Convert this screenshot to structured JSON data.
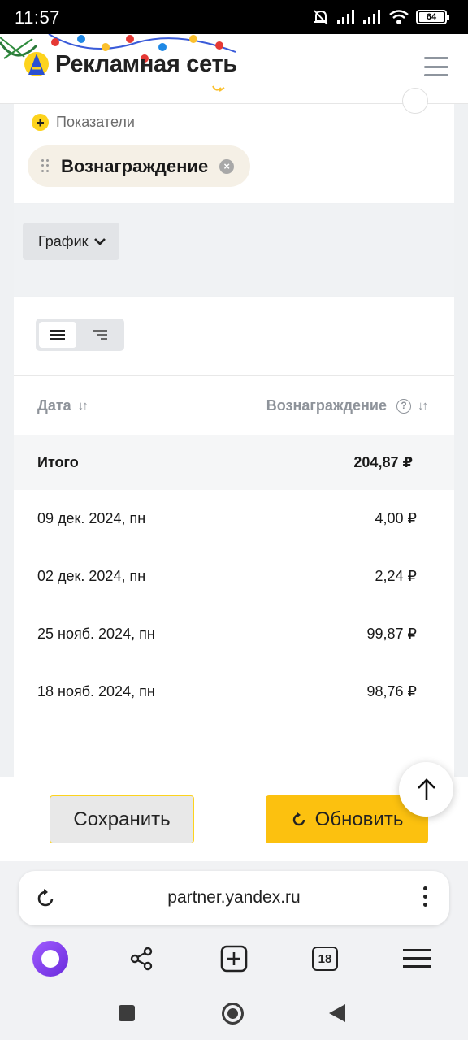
{
  "status_bar": {
    "time": "11:57",
    "battery": "64"
  },
  "header": {
    "brand": "Рекламная сеть"
  },
  "indicators": {
    "add_label": "Показатели",
    "chip_label": "Вознаграждение"
  },
  "graph": {
    "button_label": "График"
  },
  "table": {
    "columns": {
      "date": "Дата",
      "reward": "Вознаграждение"
    },
    "total": {
      "label": "Итого",
      "value": "204,87 ₽"
    },
    "rows": [
      {
        "date": "09 дек. 2024, пн",
        "value": "4,00 ₽"
      },
      {
        "date": "02 дек. 2024, пн",
        "value": "2,24 ₽"
      },
      {
        "date": "25 нояб. 2024, пн",
        "value": "99,87 ₽"
      },
      {
        "date": "18 нояб. 2024, пн",
        "value": "98,76 ₽"
      }
    ]
  },
  "actions": {
    "save_label": "Сохранить",
    "refresh_label": "Обновить"
  },
  "browser": {
    "url": "partner.yandex.ru",
    "tabs_count": "18"
  },
  "colors": {
    "accent_yellow": "#fcc10f",
    "chip_bg": "#f5f0e6",
    "alice_purple": "#7b3ef0"
  }
}
